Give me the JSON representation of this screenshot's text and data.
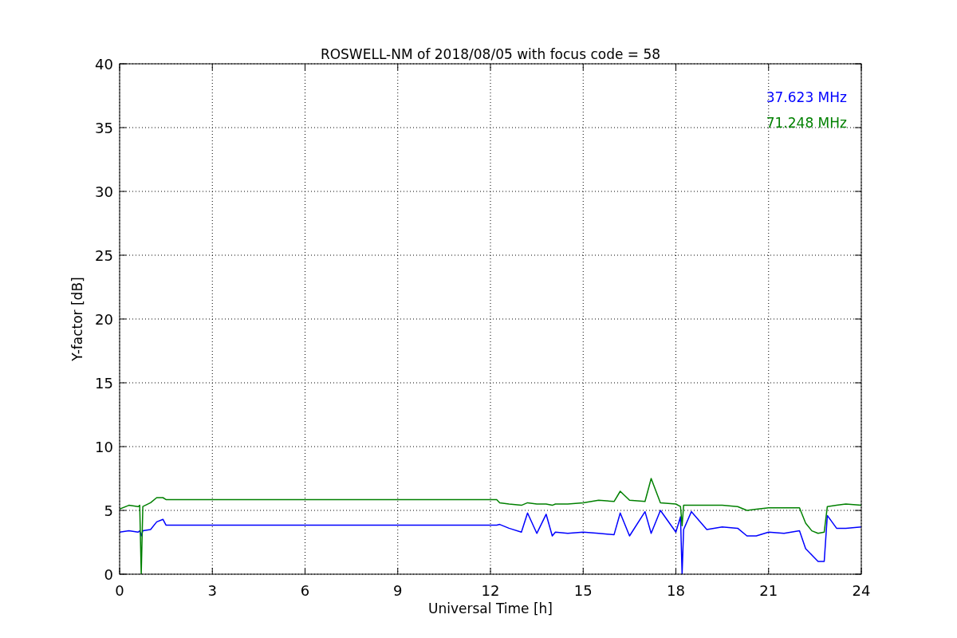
{
  "chart_data": {
    "type": "line",
    "title": "ROSWELL-NM of 2018/08/05 with focus code = 58",
    "xlabel": "Universal Time [h]",
    "ylabel": "Y-factor [dB]",
    "x": [
      0,
      0.3,
      0.6,
      0.65,
      0.7,
      0.75,
      1.0,
      1.2,
      1.4,
      1.5,
      3,
      6,
      9,
      12.2,
      12.3,
      12.6,
      13.0,
      13.2,
      13.5,
      13.8,
      14.0,
      14.1,
      14.5,
      15,
      15.5,
      16,
      16.2,
      16.5,
      17,
      17.2,
      17.5,
      18,
      18.15,
      18.2,
      18.25,
      18.5,
      19,
      19.5,
      20,
      20.3,
      20.6,
      21,
      21.5,
      22,
      22.2,
      22.4,
      22.6,
      22.8,
      22.9,
      23.2,
      23.5,
      24
    ],
    "series": [
      {
        "name": "37.623 MHz",
        "color": "#0000ff",
        "values": [
          3.3,
          3.4,
          3.3,
          3.4,
          3.0,
          3.4,
          3.5,
          4.1,
          4.3,
          3.85,
          3.85,
          3.85,
          3.85,
          3.85,
          3.9,
          3.6,
          3.3,
          4.8,
          3.2,
          4.7,
          3.0,
          3.3,
          3.2,
          3.3,
          3.2,
          3.1,
          4.8,
          3.0,
          4.9,
          3.2,
          5.0,
          3.3,
          4.5,
          0,
          3.5,
          4.9,
          3.5,
          3.7,
          3.6,
          3.0,
          3.0,
          3.3,
          3.2,
          3.4,
          2.0,
          1.5,
          1.0,
          1.0,
          4.6,
          3.6,
          3.6,
          3.7
        ]
      },
      {
        "name": "71.248 MHz",
        "color": "#008000",
        "values": [
          5.1,
          5.4,
          5.3,
          5.4,
          0,
          5.3,
          5.6,
          6.0,
          6.0,
          5.85,
          5.85,
          5.85,
          5.85,
          5.85,
          5.6,
          5.5,
          5.4,
          5.6,
          5.5,
          5.5,
          5.4,
          5.5,
          5.5,
          5.6,
          5.8,
          5.7,
          6.5,
          5.8,
          5.7,
          7.5,
          5.6,
          5.5,
          5.3,
          3.8,
          5.4,
          5.4,
          5.4,
          5.4,
          5.3,
          5.0,
          5.1,
          5.2,
          5.2,
          5.2,
          4.0,
          3.4,
          3.2,
          3.3,
          5.3,
          5.4,
          5.5,
          5.4
        ]
      }
    ],
    "grid": true,
    "xlim": [
      0,
      24
    ],
    "ylim": [
      0,
      40
    ],
    "xticks": [
      0,
      3,
      6,
      9,
      12,
      15,
      18,
      21,
      24
    ],
    "yticks": [
      0,
      5,
      10,
      15,
      20,
      25,
      30,
      35,
      40
    ]
  }
}
